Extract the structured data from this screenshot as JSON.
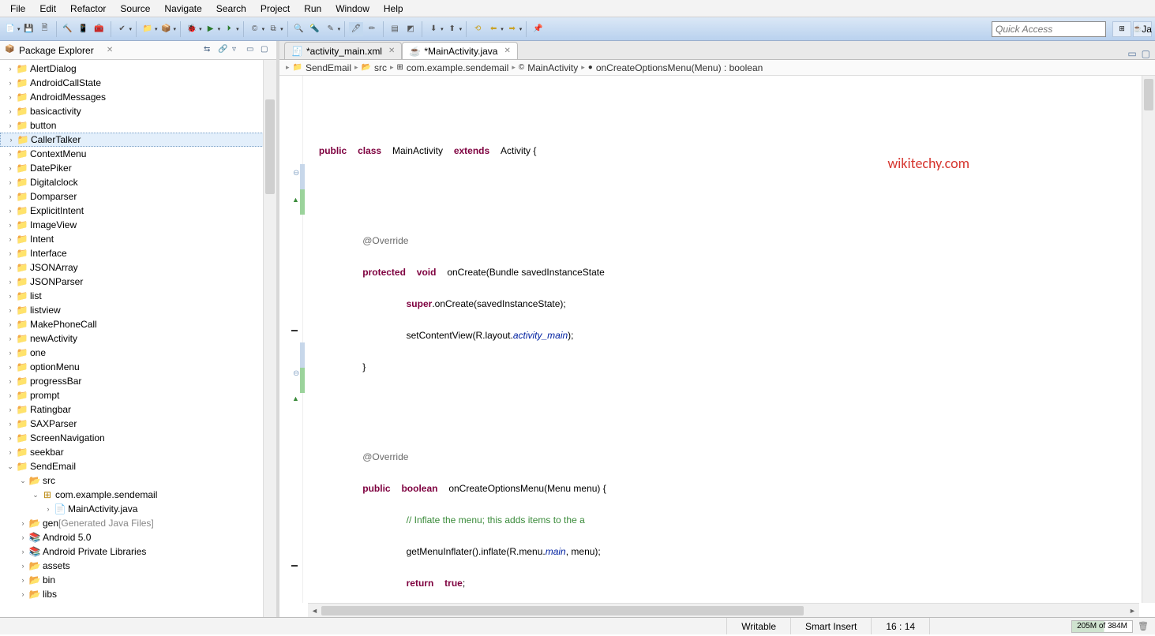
{
  "menu": [
    "File",
    "Edit",
    "Refactor",
    "Source",
    "Navigate",
    "Search",
    "Project",
    "Run",
    "Window",
    "Help"
  ],
  "quick_placeholder": "Quick Access",
  "perspective_label": "Ja",
  "package_explorer": {
    "title": "Package Explorer",
    "items": [
      {
        "l": "AlertDialog",
        "t": "prj",
        "d": 0,
        "tw": "›"
      },
      {
        "l": "AndroidCallState",
        "t": "prj",
        "d": 0,
        "tw": "›"
      },
      {
        "l": "AndroidMessages",
        "t": "prj",
        "d": 0,
        "tw": "›"
      },
      {
        "l": "basicactivity",
        "t": "prj",
        "d": 0,
        "tw": "›"
      },
      {
        "l": "button",
        "t": "prj",
        "d": 0,
        "tw": "›"
      },
      {
        "l": "CallerTalker",
        "t": "prj",
        "d": 0,
        "tw": "›",
        "sel": true
      },
      {
        "l": "ContextMenu",
        "t": "prj",
        "d": 0,
        "tw": "›"
      },
      {
        "l": "DatePiker",
        "t": "prj",
        "d": 0,
        "tw": "›"
      },
      {
        "l": "Digitalclock",
        "t": "prj",
        "d": 0,
        "tw": "›"
      },
      {
        "l": "Domparser",
        "t": "prj",
        "d": 0,
        "tw": "›"
      },
      {
        "l": "ExplicitIntent",
        "t": "prj",
        "d": 0,
        "tw": "›"
      },
      {
        "l": "ImageView",
        "t": "prj",
        "d": 0,
        "tw": "›"
      },
      {
        "l": "Intent",
        "t": "prj",
        "d": 0,
        "tw": "›"
      },
      {
        "l": "Interface",
        "t": "prj",
        "d": 0,
        "tw": "›"
      },
      {
        "l": "JSONArray",
        "t": "prj",
        "d": 0,
        "tw": "›"
      },
      {
        "l": "JSONParser",
        "t": "prj",
        "d": 0,
        "tw": "›"
      },
      {
        "l": "list",
        "t": "prj",
        "d": 0,
        "tw": "›"
      },
      {
        "l": "listview",
        "t": "prj",
        "d": 0,
        "tw": "›"
      },
      {
        "l": "MakePhoneCall",
        "t": "prj",
        "d": 0,
        "tw": "›"
      },
      {
        "l": "newActivity",
        "t": "prj",
        "d": 0,
        "tw": "›"
      },
      {
        "l": "one",
        "t": "prj",
        "d": 0,
        "tw": "›"
      },
      {
        "l": "optionMenu",
        "t": "prj",
        "d": 0,
        "tw": "›"
      },
      {
        "l": "progressBar",
        "t": "prj",
        "d": 0,
        "tw": "›"
      },
      {
        "l": "prompt",
        "t": "prj",
        "d": 0,
        "tw": "›"
      },
      {
        "l": "Ratingbar",
        "t": "prj",
        "d": 0,
        "tw": "›"
      },
      {
        "l": "SAXParser",
        "t": "prj",
        "d": 0,
        "tw": "›"
      },
      {
        "l": "ScreenNavigation",
        "t": "prj",
        "d": 0,
        "tw": "›"
      },
      {
        "l": "seekbar",
        "t": "prj",
        "d": 0,
        "tw": "›"
      },
      {
        "l": "SendEmail",
        "t": "prj",
        "d": 0,
        "tw": "⌄"
      },
      {
        "l": "src",
        "t": "fld",
        "d": 1,
        "tw": "⌄"
      },
      {
        "l": "com.example.sendemail",
        "t": "pkg",
        "d": 2,
        "tw": "⌄"
      },
      {
        "l": "MainActivity.java",
        "t": "jfile",
        "d": 3,
        "tw": "›"
      },
      {
        "l": "gen",
        "t": "fld",
        "d": 1,
        "tw": "›",
        "extra": "[Generated Java Files]"
      },
      {
        "l": "Android 5.0",
        "t": "lib",
        "d": 1,
        "tw": "›"
      },
      {
        "l": "Android Private Libraries",
        "t": "lib",
        "d": 1,
        "tw": "›"
      },
      {
        "l": "assets",
        "t": "fld",
        "d": 1,
        "tw": "›"
      },
      {
        "l": "bin",
        "t": "fld",
        "d": 1,
        "tw": "›"
      },
      {
        "l": "libs",
        "t": "fld",
        "d": 1,
        "tw": "›"
      }
    ]
  },
  "tabs": [
    {
      "label": "*activity_main.xml",
      "active": false
    },
    {
      "label": "*MainActivity.java",
      "active": true
    }
  ],
  "breadcrumb": [
    "SendEmail",
    "src",
    "com.example.sendemail",
    "MainActivity",
    "onCreateOptionsMenu(Menu) : boolean"
  ],
  "watermark": "wikitechy.com",
  "code": {
    "l1_kw1": "public",
    "l1_kw2": "class",
    "l1_name": "MainActivity",
    "l1_kw3": "extends",
    "l1_sup": "Activity {",
    "l2_ann": "@Override",
    "l3_kw1": "protected",
    "l3_kw2": "void",
    "l3_rest": "onCreate(Bundle savedInstanceState",
    "l4_kw": "super",
    "l4_rest": ".onCreate(savedInstanceState);",
    "l5_a": "setContentView(R.layout.",
    "l5_f": "activity_main",
    "l5_b": ");",
    "l6": "}",
    "l7_ann": "@Override",
    "l8_kw1": "public",
    "l8_kw2": "boolean",
    "l8_rest": "onCreateOptionsMenu(Menu menu) {",
    "l9_com": "// Inflate the menu; this adds items to the a",
    "l10_a": "getMenuInflater().inflate(R.menu.",
    "l10_f": "main",
    "l10_b": ", menu);",
    "l11_kw1": "return",
    "l11_kw2": "true",
    "l11_b": ";",
    "l12": "}"
  },
  "status": {
    "writable": "Writable",
    "insert": "Smart Insert",
    "pos": "16 : 14",
    "mem": "205M of 384M"
  }
}
